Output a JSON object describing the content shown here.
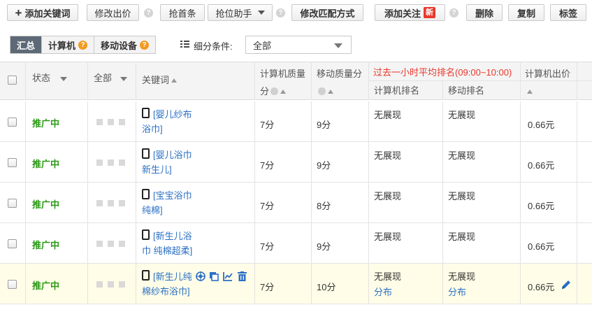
{
  "toolbar": {
    "add_keyword": "添加关键词",
    "modify_bid": "修改出价",
    "grab_first": "抢首条",
    "bid_assistant": "抢位助手",
    "modify_match": "修改匹配方式",
    "add_watch": "添加关注",
    "new_badge": "新",
    "delete": "删除",
    "copy": "复制",
    "tag": "标签"
  },
  "filters": {
    "tabs": [
      {
        "label": "汇总"
      },
      {
        "label": "计算机"
      },
      {
        "label": "移动设备"
      }
    ],
    "subdivide_label": "细分条件:",
    "select_value": "全部"
  },
  "table": {
    "headers": {
      "status": "状态",
      "all": "全部",
      "keyword": "关键词",
      "pc_quality_l1": "计算机质量",
      "pc_quality_l2": "分",
      "mobile_quality": "移动质量分",
      "avg_rank_title": "过去一小时平均排名(09:00~10:00)",
      "pc_rank": "计算机排名",
      "mobile_rank": "移动排名",
      "pc_bid": "计算机出价"
    },
    "rows": [
      {
        "status": "推广中",
        "kw1": "[婴儿纱布",
        "kw2": "浴巾]",
        "pc_q": "7分",
        "m_q": "9分",
        "pc_rank": "无展现",
        "m_rank": "无展现",
        "bid": "0.66元"
      },
      {
        "status": "推广中",
        "kw1": "[婴儿浴巾",
        "kw2": "新生儿]",
        "pc_q": "7分",
        "m_q": "9分",
        "pc_rank": "无展现",
        "m_rank": "无展现",
        "bid": "0.66元"
      },
      {
        "status": "推广中",
        "kw1": "[宝宝浴巾",
        "kw2": "纯棉]",
        "pc_q": "7分",
        "m_q": "8分",
        "pc_rank": "无展现",
        "m_rank": "无展现",
        "bid": "0.66元"
      },
      {
        "status": "推广中",
        "kw1": "[新生儿浴",
        "kw2": "巾 纯棉超柔]",
        "pc_q": "7分",
        "m_q": "9分",
        "pc_rank": "无展现",
        "m_rank": "无展现",
        "bid": "0.66元"
      },
      {
        "status": "推广中",
        "kw1": "[新生儿纯",
        "kw2": "棉纱布浴巾]",
        "pc_q": "7分",
        "m_q": "10分",
        "pc_rank": "无展现",
        "pc_rank_link": "分布",
        "m_rank": "无展现",
        "m_rank_link": "分布",
        "bid": "0.66元"
      }
    ]
  },
  "colors": {
    "status_green": "#2a9a14",
    "link_blue": "#2a6fc4",
    "accent_red": "#e8382b",
    "active_tab": "#5d6976",
    "highlight_row": "#fffde7"
  }
}
